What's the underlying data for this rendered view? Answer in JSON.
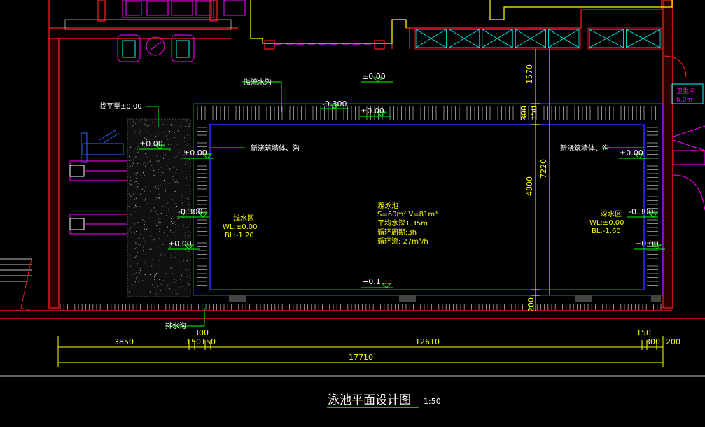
{
  "colors": {
    "background": "#000000",
    "wall": "#ff2020",
    "pool_outline": "#2a2aff",
    "dimension": "#ffff00",
    "leader": "#00ff00",
    "text": "#ffffff",
    "furniture": "#ff00ff",
    "accent_cyan": "#00ffff"
  },
  "title": {
    "text": "泳池平面设计图",
    "scale": "1:50"
  },
  "labels": {
    "overflow_gutter": "溢流水沟",
    "level_label": "找平至±0.00",
    "pool_wall_left": "新浇筑墙体、沟",
    "pool_wall_right": "新浇筑墙体、沟",
    "drain_gutter": "排水沟",
    "restroom": "卫生间",
    "restroom_area": "6.0m²"
  },
  "levels": {
    "top_deck": "±0.00",
    "gutter": "-0.300",
    "pool_rim": "±0.00",
    "left_deck": "±0.00",
    "left_rim": "±0.00",
    "left_step": "-0.300",
    "left_low": "±0.00",
    "right_rim": "±0.00",
    "right_step": "-0.300",
    "right_low": "±0.00",
    "bottom": "+0.1"
  },
  "shallow_zone": {
    "title": "浅水区",
    "wl": "WL:±0.00",
    "bl": "BL:-1.20"
  },
  "deep_zone": {
    "title": "深水区",
    "wl": "WL:±0.00",
    "bl": "BL:-1.60"
  },
  "pool_info": {
    "name": "游泳池",
    "area_volume": "S=60m² V=81m³",
    "avg_depth": "平均水深1.35m",
    "cycle": "循环周期:3h",
    "flow": "循环流: 27m³/h"
  },
  "dims_vertical": {
    "v1570": "1570",
    "v300": "300",
    "v150": "150",
    "v7220": "7220",
    "v4800": "4800",
    "v200": "200"
  },
  "dims_horizontal": {
    "d3850": "3850",
    "d150a": "150",
    "d150b": "150",
    "d300": "300",
    "d12610": "12610",
    "d150r": "150",
    "d300r": "300",
    "d200r": "200",
    "total": "17710"
  }
}
